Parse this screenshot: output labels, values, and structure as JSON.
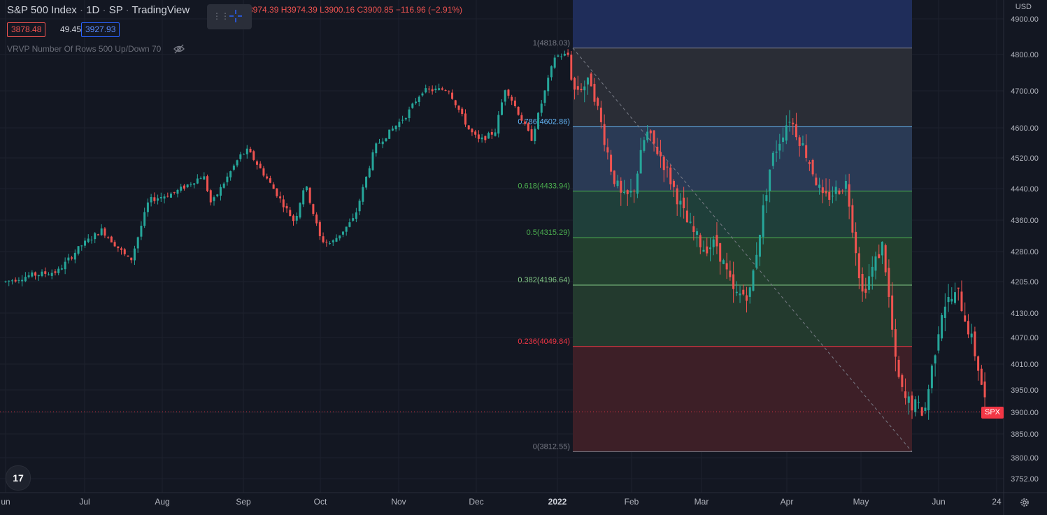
{
  "header": {
    "symbol": "S&P 500 Index",
    "interval": "1D",
    "exchange": "SP",
    "source": "TradingView",
    "ohlc_text": "3974.39 H3974.39 L3900.16 C3900.85 −116.96 (−2.91%)"
  },
  "price_boxes": {
    "low": "3878.48",
    "spread": "49.45",
    "high": "3927.93"
  },
  "indicator": {
    "label": "VRVP Number Of Rows 500 Up/Down 70"
  },
  "currency_label": "USD",
  "logo_text": "17",
  "last_price_tag": {
    "label": "SPX"
  },
  "colors": {
    "up": "#26a69a",
    "down": "#ef5350",
    "background": "#131722",
    "grid": "#1e222d"
  },
  "chart_data": {
    "type": "candlestick",
    "title": "S&P 500 Index",
    "y_ticks": [
      "4900.00",
      "4800.00",
      "4700.00",
      "4600.00",
      "4520.00",
      "4440.00",
      "4360.00",
      "4280.00",
      "4205.00",
      "4130.00",
      "4070.00",
      "4010.00",
      "3950.00",
      "3900.00",
      "3850.00",
      "3800.00",
      "3752.00"
    ],
    "x_ticks": [
      "un",
      "Jul",
      "Aug",
      "Sep",
      "Oct",
      "Nov",
      "Dec",
      "2022",
      "Feb",
      "Mar",
      "Apr",
      "May",
      "Jun",
      "24"
    ],
    "last_close": 3900.85,
    "fibonacci": {
      "high": 4818.03,
      "low": 3812.55,
      "levels": [
        {
          "label": "1(4818.03)",
          "ratio": 1,
          "price": 4818.03,
          "color": "#787b86"
        },
        {
          "label": "0.786(4602.86)",
          "ratio": 0.786,
          "price": 4602.86,
          "color": "#64b5f6"
        },
        {
          "label": "0.618(4433.94)",
          "ratio": 0.618,
          "price": 4433.94,
          "color": "#4caf50"
        },
        {
          "label": "0.5(4315.29)",
          "ratio": 0.5,
          "price": 4315.29,
          "color": "#4caf50"
        },
        {
          "label": "0.382(4196.64)",
          "ratio": 0.382,
          "price": 4196.64,
          "color": "#81c784"
        },
        {
          "label": "0.236(4049.84)",
          "ratio": 0.236,
          "price": 4049.84,
          "color": "#f23645"
        },
        {
          "label": "0(3812.55)",
          "ratio": 0,
          "price": 3812.55,
          "color": "#787b86"
        }
      ]
    },
    "series": [
      {
        "name": "SPX",
        "anchors": [
          [
            "2021-06-01",
            4205
          ],
          [
            "2021-06-10",
            4220
          ],
          [
            "2021-06-21",
            4230
          ],
          [
            "2021-06-30",
            4295
          ],
          [
            "2021-07-08",
            4335
          ],
          [
            "2021-07-19",
            4255
          ],
          [
            "2021-07-26",
            4410
          ],
          [
            "2021-08-05",
            4430
          ],
          [
            "2021-08-16",
            4475
          ],
          [
            "2021-08-19",
            4400
          ],
          [
            "2021-08-30",
            4525
          ],
          [
            "2021-09-02",
            4540
          ],
          [
            "2021-09-10",
            4460
          ],
          [
            "2021-09-20",
            4355
          ],
          [
            "2021-09-24",
            4455
          ],
          [
            "2021-09-30",
            4310
          ],
          [
            "2021-10-04",
            4300
          ],
          [
            "2021-10-13",
            4365
          ],
          [
            "2021-10-21",
            4550
          ],
          [
            "2021-11-02",
            4635
          ],
          [
            "2021-11-08",
            4700
          ],
          [
            "2021-11-18",
            4705
          ],
          [
            "2021-11-26",
            4595
          ],
          [
            "2021-11-30",
            4565
          ],
          [
            "2021-12-06",
            4590
          ],
          [
            "2021-12-10",
            4710
          ],
          [
            "2021-12-20",
            4570
          ],
          [
            "2021-12-29",
            4795
          ],
          [
            "2022-01-03",
            4800
          ],
          [
            "2022-01-05",
            4700
          ],
          [
            "2022-01-12",
            4725
          ],
          [
            "2022-01-20",
            4480
          ],
          [
            "2022-01-24",
            4410
          ],
          [
            "2022-01-28",
            4430
          ],
          [
            "2022-02-02",
            4590
          ],
          [
            "2022-02-08",
            4520
          ],
          [
            "2022-02-18",
            4350
          ],
          [
            "2022-02-24",
            4290
          ],
          [
            "2022-03-01",
            4300
          ],
          [
            "2022-03-08",
            4170
          ],
          [
            "2022-03-14",
            4180
          ],
          [
            "2022-03-22",
            4510
          ],
          [
            "2022-03-29",
            4630
          ],
          [
            "2022-04-05",
            4525
          ],
          [
            "2022-04-11",
            4410
          ],
          [
            "2022-04-20",
            4455
          ],
          [
            "2022-04-26",
            4175
          ],
          [
            "2022-05-04",
            4300
          ],
          [
            "2022-05-09",
            4000
          ],
          [
            "2022-05-12",
            3930
          ],
          [
            "2022-05-20",
            3900
          ],
          [
            "2022-05-27",
            4150
          ],
          [
            "2022-06-02",
            4175
          ],
          [
            "2022-06-09",
            4020
          ],
          [
            "2022-06-13",
            3900.85
          ]
        ]
      }
    ]
  }
}
